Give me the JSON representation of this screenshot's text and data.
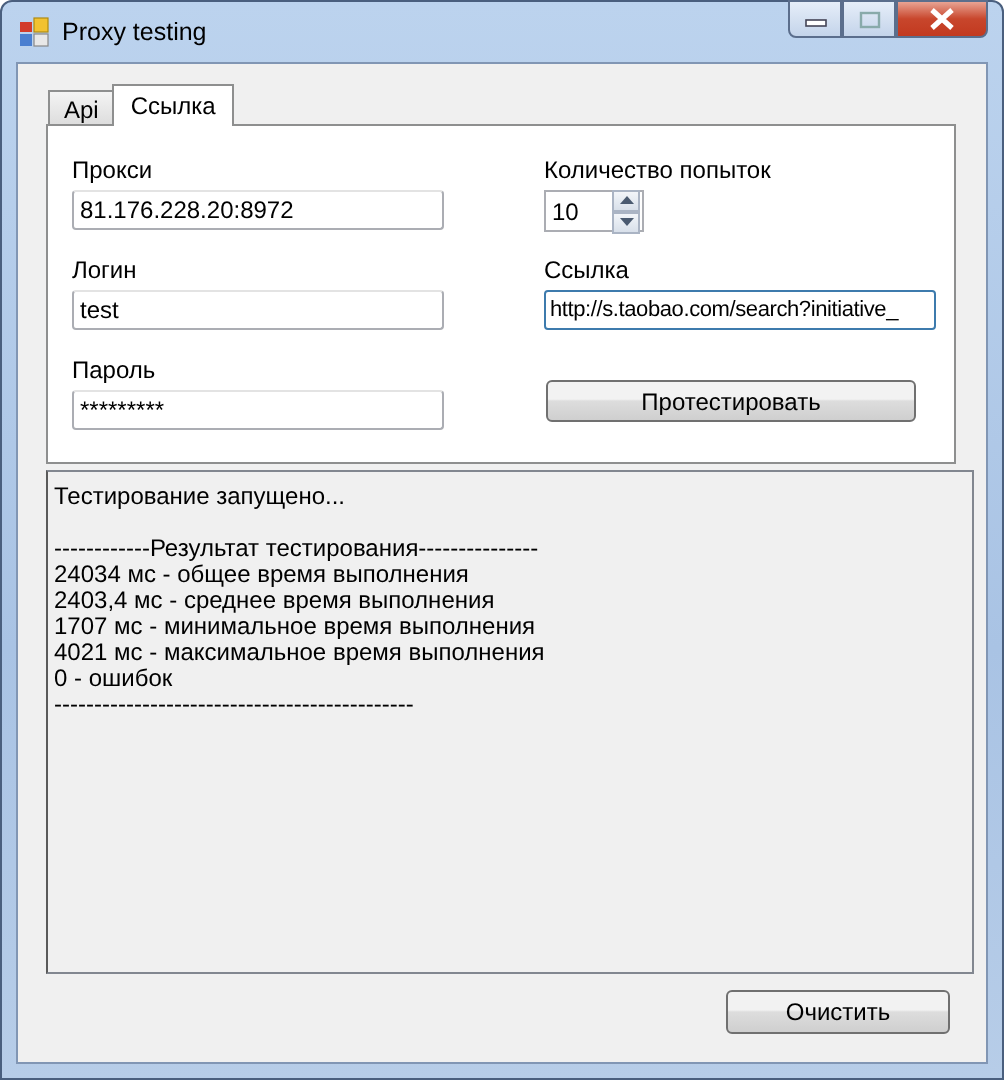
{
  "window": {
    "title": "Proxy testing"
  },
  "tabs": [
    {
      "label": "Api",
      "selected": false
    },
    {
      "label": "Ссылка",
      "selected": true
    }
  ],
  "form": {
    "proxy": {
      "label": "Прокси",
      "value": "81.176.228.20:8972"
    },
    "login": {
      "label": "Логин",
      "value": "test"
    },
    "password": {
      "label": "Пароль",
      "value": "*********"
    },
    "attempts": {
      "label": "Количество попыток",
      "value": "10"
    },
    "link": {
      "label": "Ссылка",
      "value": "http://s.taobao.com/search?initiative_",
      "focused": true
    },
    "test_button": "Протестировать"
  },
  "output": [
    [
      "Тестирование запущено..."
    ],
    [
      "------------Результат тестирования---------------",
      "24034 мс - общее время выполнения",
      "2403,4 мс - среднее время выполнения",
      "1707 мс - минимальное время выполнения",
      "4021 мс - максимальное время выполнения",
      "0 - ошибок",
      "---------------------------------------------"
    ]
  ],
  "clear_button": "Очистить"
}
